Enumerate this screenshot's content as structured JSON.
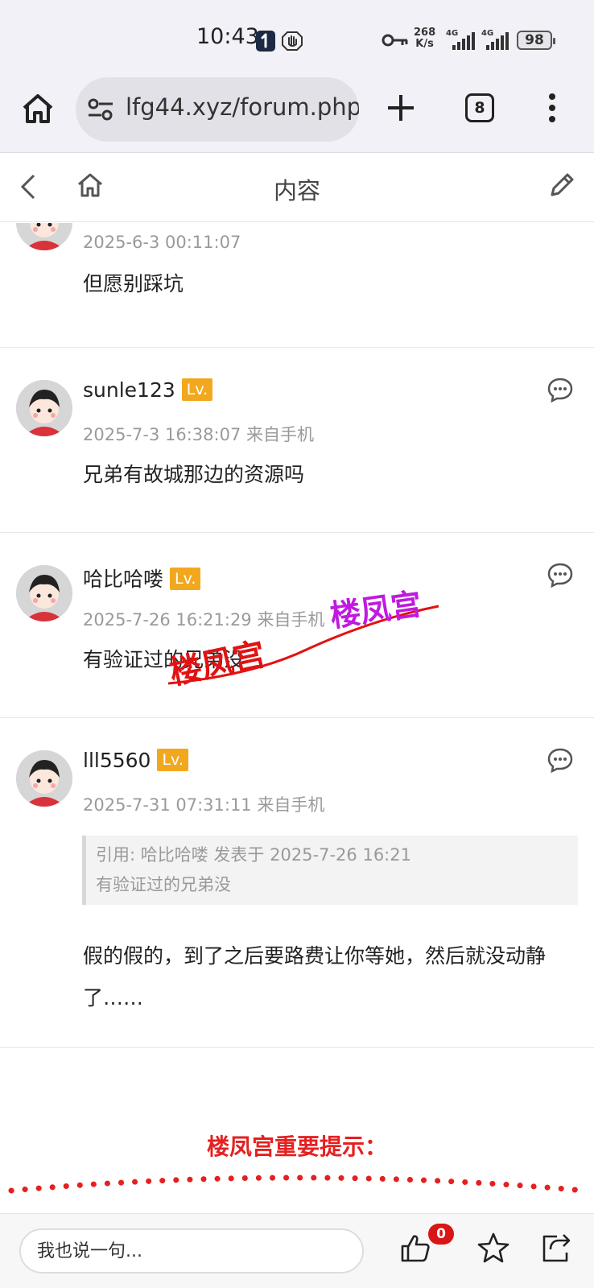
{
  "status_bar": {
    "time": "10:43",
    "speed_value": "268",
    "speed_unit": "K/s",
    "net_1": "4G",
    "net_2": "4G",
    "battery": "98"
  },
  "browser": {
    "url": "lfg44.xyz/forum.php",
    "tab_count": "8"
  },
  "header": {
    "title": "内容"
  },
  "posts": [
    {
      "username": "",
      "time": "2025-6-3 00:11:07",
      "text": "但愿别踩坑"
    },
    {
      "username": "sunle123",
      "level": "Lv.",
      "time": "2025-7-3 16:38:07 来自手机",
      "text": "兄弟有故城那边的资源吗"
    },
    {
      "username": "哈比哈喽",
      "level": "Lv.",
      "time": "2025-7-26 16:21:29 来自手机",
      "text": "有验证过的兄弟没"
    },
    {
      "username": "lll5560",
      "level": "Lv.",
      "time": "2025-7-31 07:31:11 来自手机",
      "quote_line1": "引用: 哈比哈喽 发表于 2025-7-26 16:21",
      "quote_line2": "有验证过的兄弟没",
      "text": "假的假的，到了之后要路费让你等她，然后就没动静了……"
    }
  ],
  "watermark": {
    "text_1": "楼凤宫",
    "text_2": "楼凤宫"
  },
  "notice": {
    "title": "楼凤宫重要提示："
  },
  "bottom_bar": {
    "reply_placeholder": "我也说一句...",
    "like_count": "0"
  },
  "colors": {
    "level_badge": "#f2a81e",
    "notice_red": "#e52020",
    "watermark_red": "#e21212",
    "watermark_purple": "#c01ae0",
    "like_badge": "#d91515"
  }
}
